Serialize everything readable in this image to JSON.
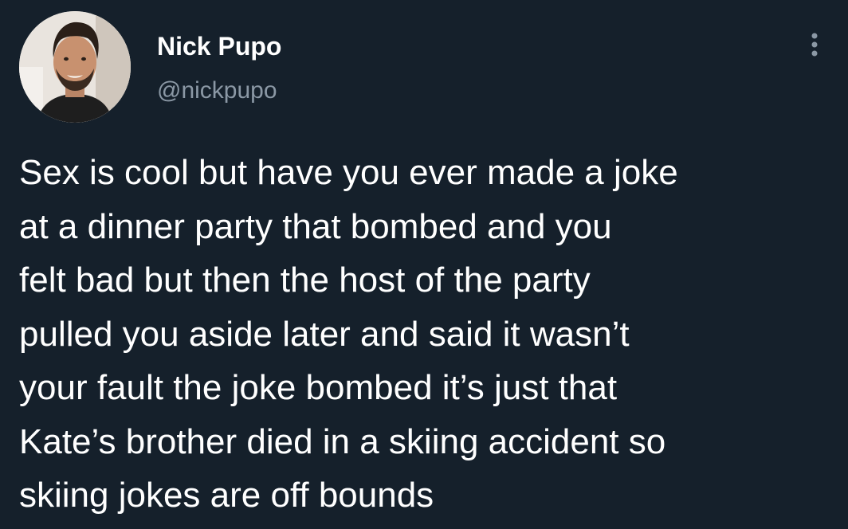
{
  "tweet": {
    "author": {
      "display_name": "Nick Pupo",
      "handle": "@nickpupo",
      "avatar_icon": "profile-photo"
    },
    "more_icon": "more-options-icon",
    "text": "Sex is cool but have you ever made a joke\nat a dinner party that bombed and you\nfelt bad but then the host of the party\npulled you aside later and said it wasn’t\nyour fault the joke bombed it’s just that\nKate’s brother died in a skiing accident so\nskiing jokes are off bounds"
  },
  "colors": {
    "background": "#15202b",
    "text": "#ffffff",
    "secondary_text": "#8b98a5"
  }
}
